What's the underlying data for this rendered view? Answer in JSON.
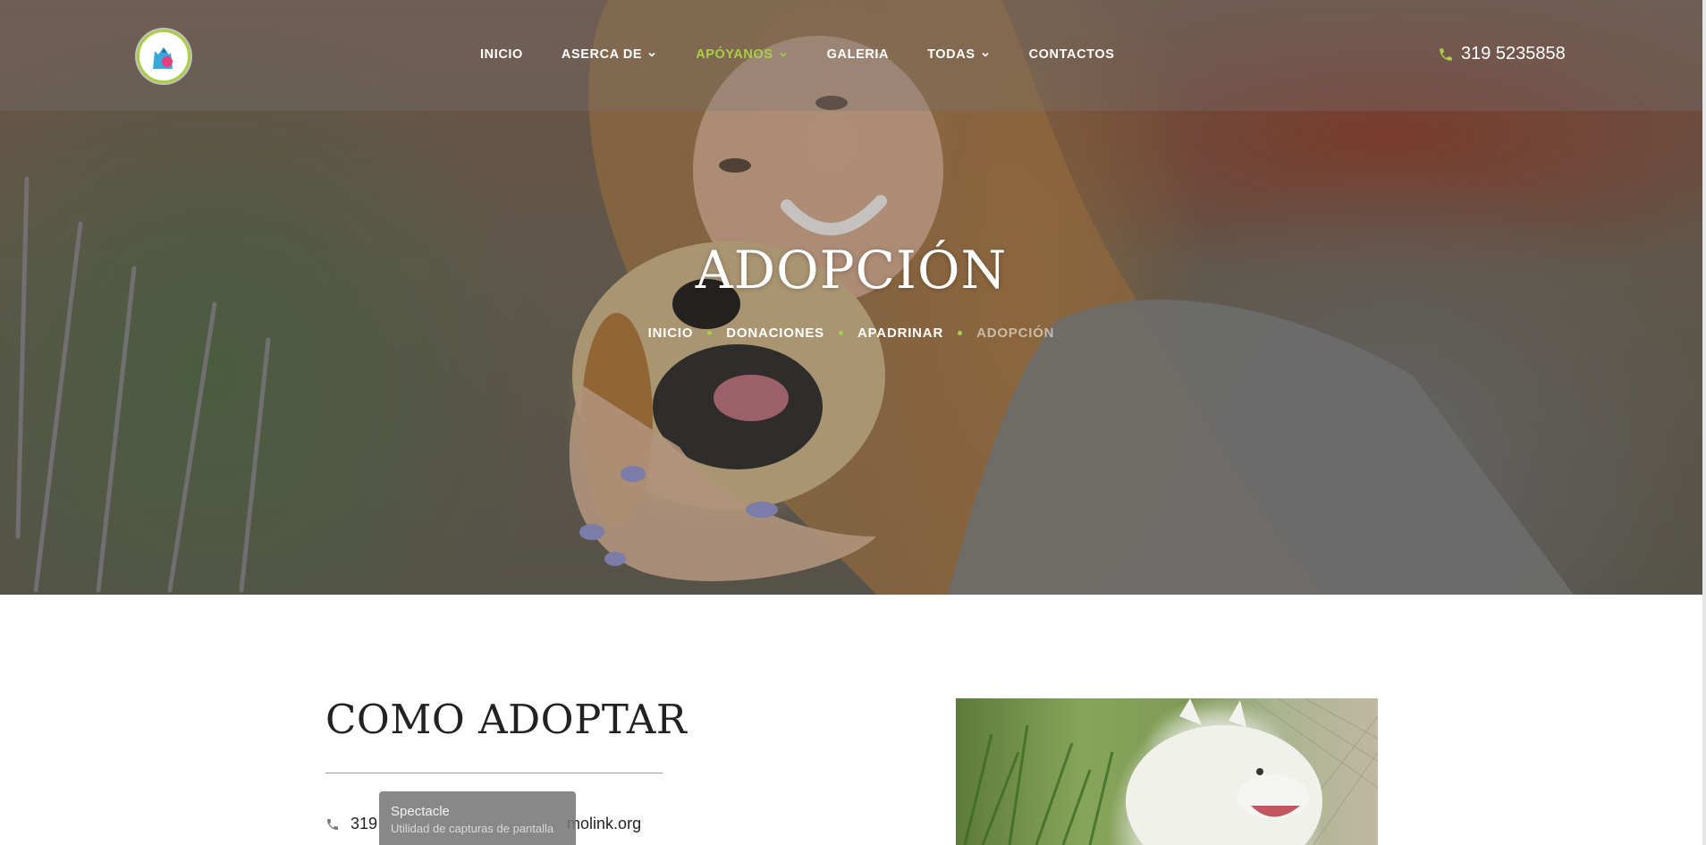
{
  "header": {
    "logo_icon": "pet-shelter-logo",
    "nav": [
      {
        "label": "INICIO",
        "has_dropdown": false,
        "active": false
      },
      {
        "label": "ASERCA DE",
        "has_dropdown": true,
        "active": false
      },
      {
        "label": "APÓYANOS",
        "has_dropdown": true,
        "active": true
      },
      {
        "label": "GALERIA",
        "has_dropdown": false,
        "active": false
      },
      {
        "label": "TODAS",
        "has_dropdown": true,
        "active": false
      },
      {
        "label": "CONTACTOS",
        "has_dropdown": false,
        "active": false
      }
    ],
    "phone_icon": "phone-icon",
    "phone": "319 5235858"
  },
  "hero": {
    "title": "ADOPCIÓN",
    "breadcrumbs": [
      "INICIO",
      "DONACIONES",
      "APADRINAR",
      "ADOPCIÓN"
    ]
  },
  "content": {
    "title": "COMO ADOPTAR",
    "contact_icon": "phone-icon",
    "contact_prefix": "319",
    "contact_suffix": "molink.org"
  },
  "tooltip": {
    "title": "Spectacle",
    "subtitle": "Utilidad de capturas de pantalla"
  },
  "colors": {
    "accent": "#a8cf45",
    "text_dark": "#222222",
    "white": "#ffffff"
  }
}
